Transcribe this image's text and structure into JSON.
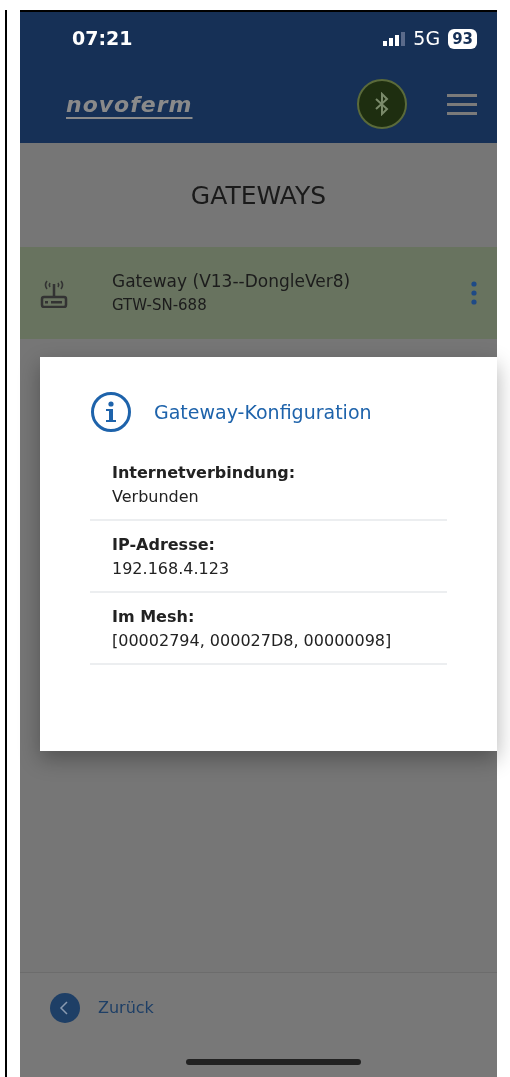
{
  "status_bar": {
    "time": "07:21",
    "network": "5G",
    "battery": "93"
  },
  "header": {
    "logo": "novoferm"
  },
  "page_title": "GATEWAYS",
  "gateways": [
    {
      "name": "Gateway (V13--DongleVer8)",
      "serial": "GTW-SN-688"
    }
  ],
  "dialog": {
    "title": "Gateway-Konfiguration",
    "fields": [
      {
        "label": "Internetverbindung:",
        "value": "Verbunden"
      },
      {
        "label": "IP-Adresse:",
        "value": "192.168.4.123"
      },
      {
        "label": "Im Mesh:",
        "value": "[00002794, 000027D8, 00000098]"
      }
    ]
  },
  "back_button": {
    "label": "Zurück"
  }
}
